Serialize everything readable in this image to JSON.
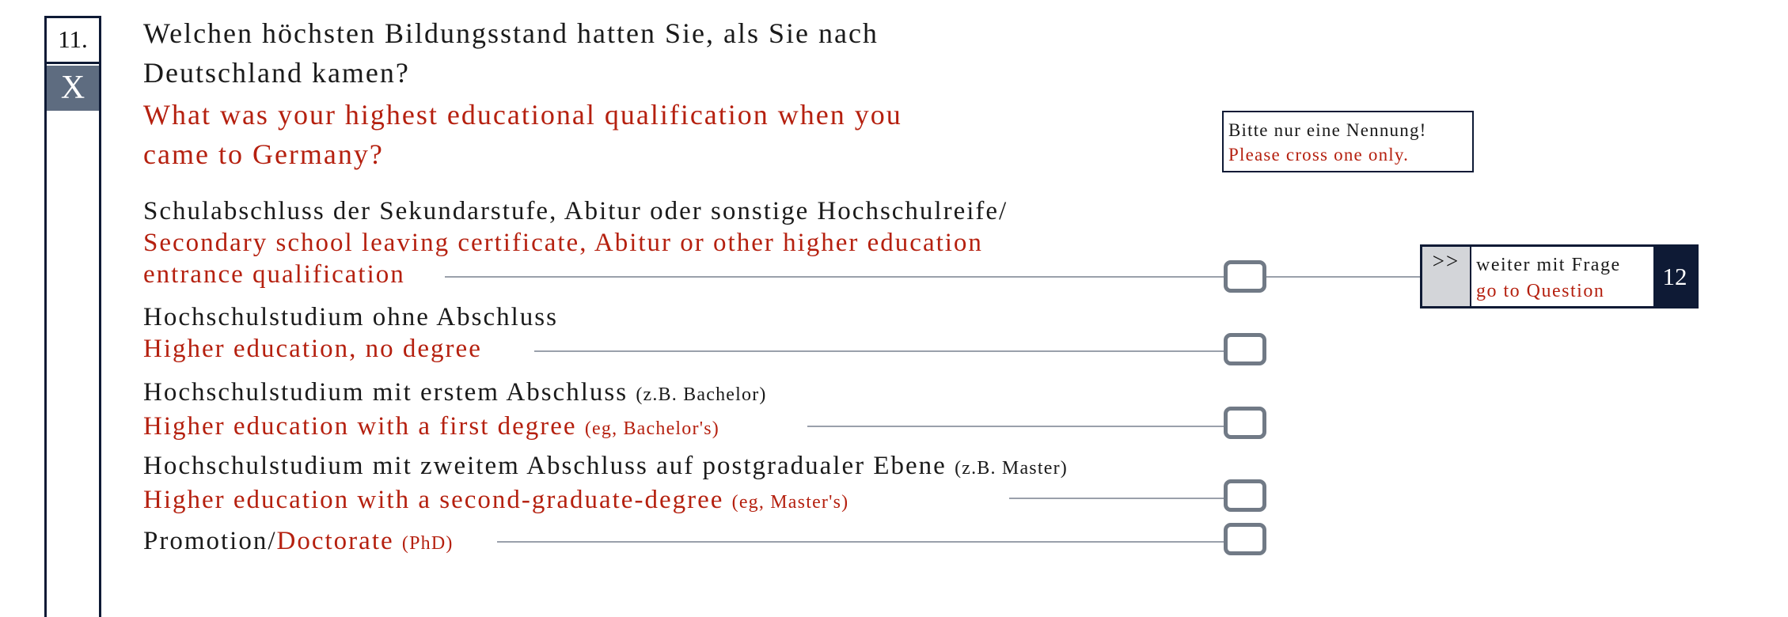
{
  "question": {
    "number": "11.",
    "cross_mark": "X",
    "de_line1": "Welchen höchsten Bildungsstand hatten Sie, als Sie nach",
    "de_line2": "Deutschland kamen?",
    "en_line1": "What was your highest educational qualification when you",
    "en_line2": "came to Germany?"
  },
  "instruction": {
    "de": "Bitte nur eine Nennung!",
    "en": "Please cross one only."
  },
  "options": [
    {
      "de": "Schulabschluss der Sekundarstufe, Abitur oder sonstige Hochschulreife/",
      "en_line1": "Secondary school leaving certificate, Abitur or other higher education",
      "en_line2": "entrance qualification"
    },
    {
      "de": "Hochschulstudium ohne Abschluss",
      "en": "Higher education, no degree"
    },
    {
      "de": "Hochschulstudium mit erstem Abschluss",
      "de_note": "(z.B. Bachelor)",
      "en": "Higher education with a first degree",
      "en_note": "(eg, Bachelor's)"
    },
    {
      "de": "Hochschulstudium mit zweitem Abschluss auf postgradualer Ebene",
      "de_note": "(z.B. Master)",
      "en": "Higher education with a second-graduate-degree",
      "en_note": "(eg, Master's)"
    },
    {
      "de": "Promotion/",
      "en": "Doctorate",
      "en_note": "(PhD)"
    }
  ],
  "skip": {
    "arrow": ">>",
    "de": "weiter mit Frage",
    "en": "go to Question",
    "target": "12"
  },
  "colors": {
    "navy": "#0e1a35",
    "english_red": "#b5200f",
    "checkbox_grey": "#717a86",
    "cross_box": "#5e6c80"
  }
}
